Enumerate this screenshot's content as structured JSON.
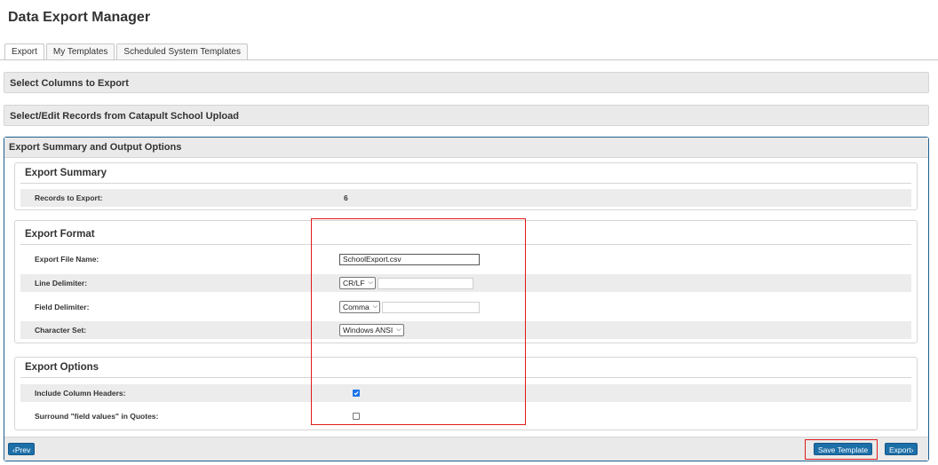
{
  "page": {
    "title": "Data Export Manager"
  },
  "tabs": [
    {
      "label": "Export",
      "active": true
    },
    {
      "label": "My Templates",
      "active": false
    },
    {
      "label": "Scheduled System Templates",
      "active": false
    }
  ],
  "sections": {
    "select_columns": "Select Columns to Export",
    "select_records": "Select/Edit Records from Catapult School Upload",
    "summary_output": "Export Summary and Output Options"
  },
  "export_summary": {
    "title": "Export Summary",
    "records_label": "Records to Export:",
    "records_value": "6"
  },
  "export_format": {
    "title": "Export Format",
    "file_name_label": "Export File Name:",
    "file_name_value": "SchoolExport.csv",
    "line_delim_label": "Line Delimiter:",
    "line_delim_value": "CR/LF",
    "field_delim_label": "Field Delimiter:",
    "field_delim_value": "Comma",
    "charset_label": "Character Set:",
    "charset_value": "Windows ANSI"
  },
  "export_options": {
    "title": "Export Options",
    "headers_label": "Include Column Headers:",
    "headers_checked": true,
    "quotes_label": "Surround \"field values\" in Quotes:",
    "quotes_checked": false
  },
  "footer": {
    "prev_label": "Prev",
    "save_template_label": "Save Template",
    "export_label": "Export"
  },
  "colors": {
    "accent": "#1d6fa8",
    "panel_border": "#1d5f8e",
    "annotation": "#e01b1b",
    "checkbox": "#1a73e8"
  }
}
